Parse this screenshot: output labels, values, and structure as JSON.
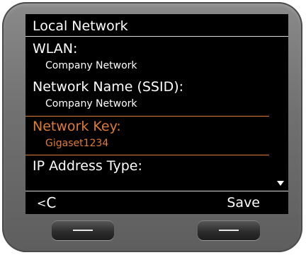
{
  "screen": {
    "title": "Local Network",
    "items": [
      {
        "label": "WLAN:",
        "value": "Company Network"
      },
      {
        "label": "Network Name (SSID):",
        "value": "Company Network"
      },
      {
        "label": "Network Key:",
        "value": "Gigaset1234"
      },
      {
        "label": "IP Address Type:"
      }
    ],
    "selected_index": 2,
    "colors": {
      "highlight": "#e07b33",
      "text": "#ffffff",
      "background": "#000000"
    }
  },
  "softkeys": {
    "left_label": "C",
    "left_icon": "arrow-left-icon",
    "right_label": "Save"
  },
  "hardware": {
    "left_key_icon": "dash-icon",
    "right_key_icon": "dash-icon"
  }
}
